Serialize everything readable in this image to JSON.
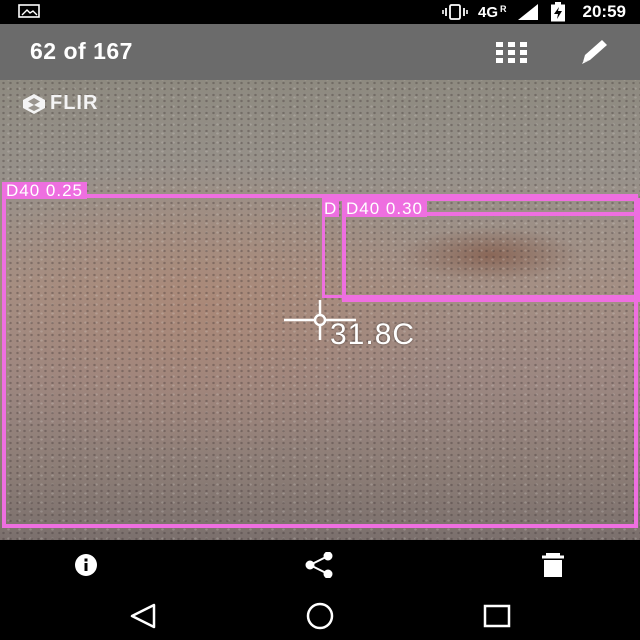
{
  "status_bar": {
    "network": "4G",
    "roaming": "R",
    "time": "20:59",
    "icons": [
      "image-icon",
      "vibrate-icon",
      "signal-icon",
      "battery-charging-icon"
    ]
  },
  "toolbar": {
    "title": "62 of 167",
    "icons": [
      "grid-icon",
      "edit-icon"
    ]
  },
  "image": {
    "logo_text": "FLIR",
    "temperature": "31.8C",
    "detections": [
      {
        "label": "D40  0.25"
      },
      {
        "label": "D40  0.30"
      },
      {
        "label": "D"
      }
    ]
  },
  "action_bar": {
    "icons": [
      "info-icon",
      "share-icon",
      "delete-icon"
    ]
  },
  "nav_bar": {
    "icons": [
      "back-icon",
      "home-icon",
      "recents-icon"
    ]
  },
  "colors": {
    "toolbar_bg": "#6b6b6b",
    "detection_box": "#ee6fe0",
    "bars_bg": "#000000"
  }
}
